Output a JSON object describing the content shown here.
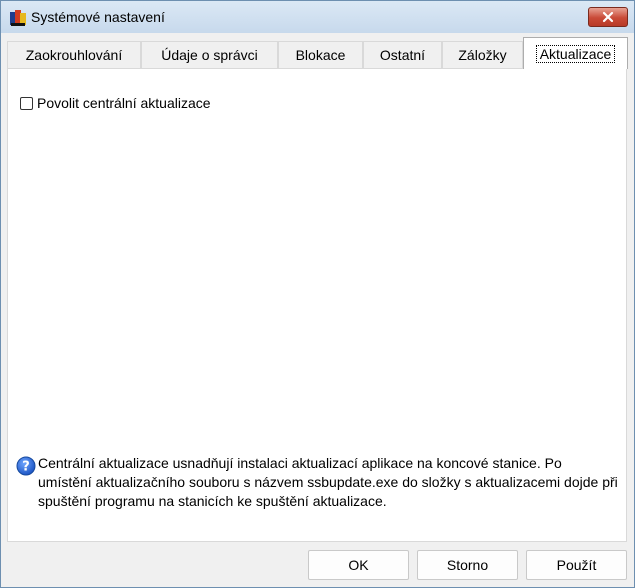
{
  "window": {
    "title": "Systémové nastavení"
  },
  "tabs": [
    {
      "label": "Zaokrouhlování"
    },
    {
      "label": "Údaje o správci"
    },
    {
      "label": "Blokace"
    },
    {
      "label": "Ostatní"
    },
    {
      "label": "Záložky"
    },
    {
      "label": "Aktualizace",
      "active": true
    }
  ],
  "settings": {
    "enable_central_updates": {
      "label": "Povolit centrální aktualizace",
      "checked": false
    },
    "info_text": "Centrální aktualizace usnadňují instalaci aktualizací aplikace na koncové stanice. Po umístění aktualizačního souboru s názvem ssbupdate.exe do složky s aktualizacemi dojde při spuštění programu na stanicích ke spuštění aktualizace."
  },
  "buttons": {
    "ok": "OK",
    "cancel": "Storno",
    "apply": "Použít"
  },
  "icons": {
    "app": "app-icon",
    "close": "close-icon",
    "info": "info-icon"
  },
  "colors": {
    "close_button": "#c94a37",
    "info_icon": "#2a6ad1"
  }
}
